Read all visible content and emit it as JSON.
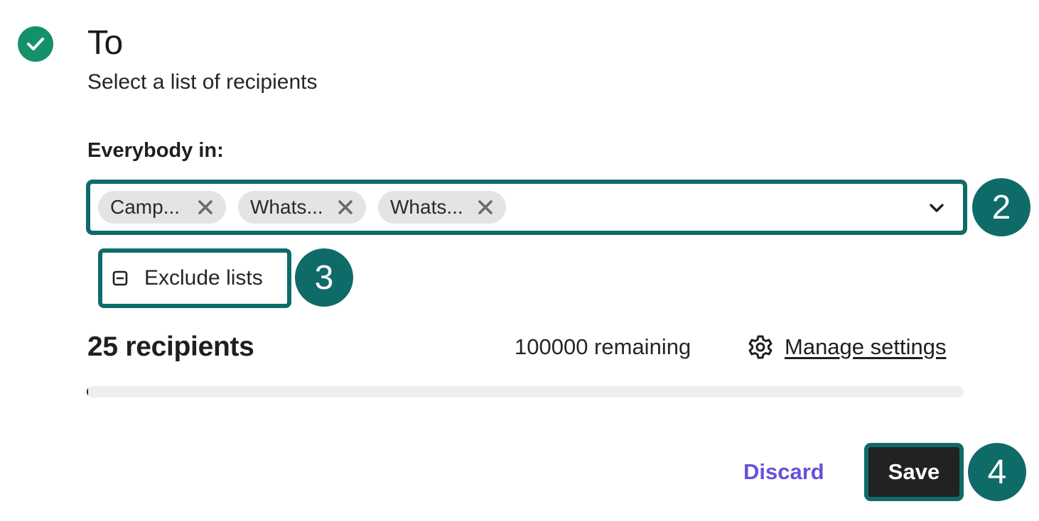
{
  "section": {
    "title": "To",
    "subtitle": "Select a list of recipients",
    "status_icon": "check-icon",
    "status_color": "#14916a"
  },
  "recipients_field": {
    "label": "Everybody in:",
    "chips": [
      {
        "label": "Camp...",
        "remove_icon": "close-icon"
      },
      {
        "label": "Whats...",
        "remove_icon": "close-icon"
      },
      {
        "label": "Whats...",
        "remove_icon": "close-icon"
      }
    ],
    "dropdown_icon": "chevron-down-icon"
  },
  "exclude": {
    "label": "Exclude lists",
    "icon": "minus-square-icon"
  },
  "summary": {
    "count_text": "25 recipients",
    "remaining_text": "100000 remaining",
    "settings_icon": "gear-icon",
    "manage_link": "Manage settings",
    "usage_fraction": 0.00025
  },
  "actions": {
    "discard_label": "Discard",
    "save_label": "Save",
    "discard_color": "#6a4fdc"
  },
  "step_badges": [
    "2",
    "3",
    "4"
  ],
  "accent_color": "#0f6b68"
}
